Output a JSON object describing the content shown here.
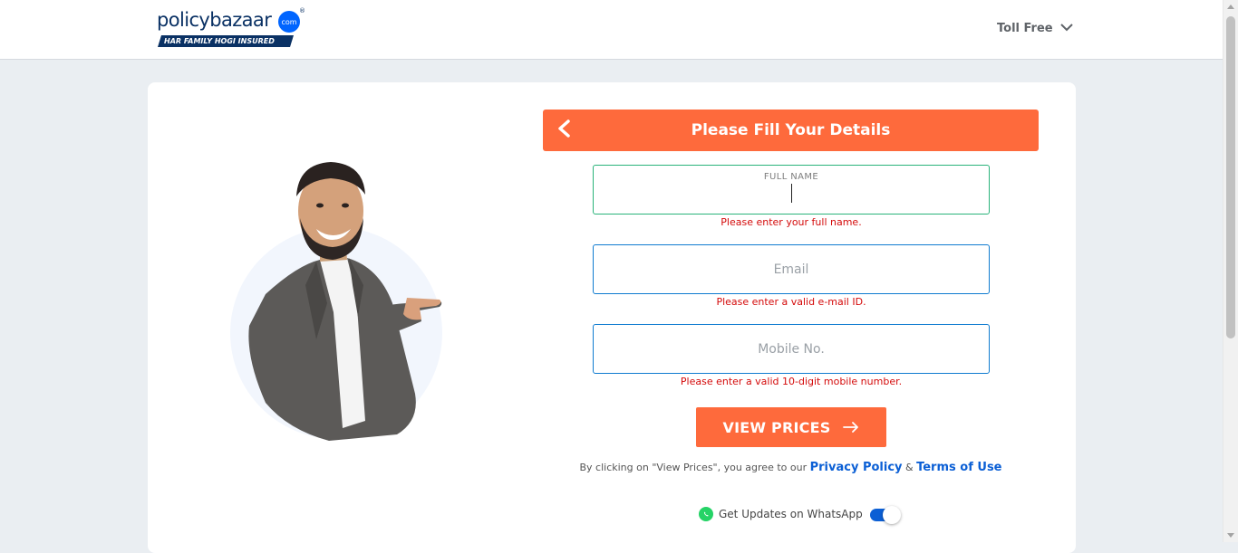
{
  "header": {
    "logo": {
      "brand_part1": "policy",
      "brand_part2": "bazaar",
      "dot_text": "com",
      "registered": "®",
      "tagline": "HAR FAMILY HOGI INSURED"
    },
    "toll_free_label": "Toll Free"
  },
  "form": {
    "title": "Please Fill Your Details",
    "fields": {
      "full_name": {
        "label": "FULL NAME",
        "value": "",
        "error": "Please enter your full name."
      },
      "email": {
        "placeholder": "Email",
        "value": "",
        "error": "Please enter a valid e-mail ID."
      },
      "mobile": {
        "placeholder": "Mobile No.",
        "value": "",
        "error": "Please enter a valid 10-digit mobile number."
      }
    },
    "submit_label": "VIEW PRICES",
    "consent": {
      "prefix": "By clicking on \"View Prices\", you agree to our",
      "privacy_label": "Privacy Policy",
      "amp": "&",
      "terms_label": "Terms of Use"
    },
    "whatsapp": {
      "label": "Get Updates on WhatsApp",
      "enabled": true
    }
  },
  "colors": {
    "accent": "#fe6a3c",
    "brand_navy": "#0a3164",
    "link_blue": "#0b5fd5",
    "error_red": "#d40a0a",
    "active_border": "#2ab37a",
    "field_border": "#0f7bd0"
  },
  "icons": {
    "back": "chevron-left-icon",
    "dropdown": "chevron-down-icon",
    "submit_arrow": "arrow-right-icon",
    "whatsapp": "whatsapp-icon"
  }
}
